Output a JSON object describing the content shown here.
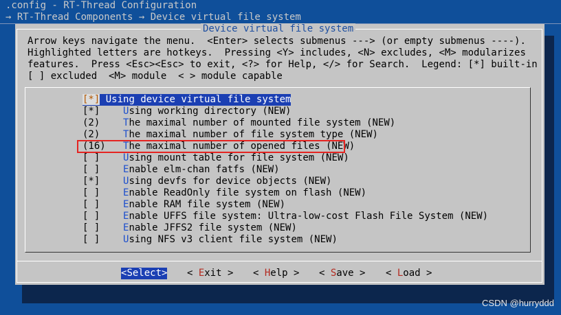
{
  "terminal": {
    "title": ".config - RT-Thread Configuration",
    "breadcrumb": "→ RT-Thread Components → Device virtual file system"
  },
  "dialog": {
    "title": "Device virtual file system",
    "help_lines": [
      "Arrow keys navigate the menu.  <Enter> selects submenus ---> (or empty submenus ----).",
      "Highlighted letters are hotkeys.  Pressing <Y> includes, <N> excludes, <M> modularizes",
      "features.  Press <Esc><Esc> to exit, <?> for Help, </> for Search.  Legend: [*] built-in",
      "[ ] excluded  <M> module  < > module capable"
    ]
  },
  "menu": {
    "items": [
      {
        "mark": "[*]",
        "hotkey": "U",
        "rest": "sing device virtual file system",
        "selected": true
      },
      {
        "mark": "[*]",
        "hotkey": "U",
        "rest": "sing working directory (NEW)"
      },
      {
        "mark": "(2)",
        "hotkey": "T",
        "rest": "he maximal number of mounted file system (NEW)"
      },
      {
        "mark": "(2)",
        "hotkey": "T",
        "rest": "he maximal number of file system type (NEW)"
      },
      {
        "mark": "(16)",
        "hotkey": "T",
        "rest": "he maximal number of opened files (NEW)",
        "highlighted": true
      },
      {
        "mark": "[ ]",
        "hotkey": "U",
        "rest": "sing mount table for file system (NEW)"
      },
      {
        "mark": "[ ]",
        "hotkey": "E",
        "rest": "nable elm-chan fatfs (NEW)"
      },
      {
        "mark": "[*]",
        "hotkey": "U",
        "rest": "sing devfs for device objects (NEW)"
      },
      {
        "mark": "[ ]",
        "hotkey": "E",
        "rest": "nable ReadOnly file system on flash (NEW)"
      },
      {
        "mark": "[ ]",
        "hotkey": "E",
        "rest": "nable RAM file system (NEW)"
      },
      {
        "mark": "[ ]",
        "hotkey": "E",
        "rest": "nable UFFS file system: Ultra-low-cost Flash File System (NEW)"
      },
      {
        "mark": "[ ]",
        "hotkey": "E",
        "rest": "nable JFFS2 file system (NEW)"
      },
      {
        "mark": "[ ]",
        "hotkey": "U",
        "rest": "sing NFS v3 client file system (NEW)"
      }
    ]
  },
  "buttons": {
    "select": {
      "pre": "<",
      "hotkey": "S",
      "post": "elect>"
    },
    "exit": {
      "pre": "< ",
      "hotkey": "E",
      "post": "xit >"
    },
    "help": {
      "pre": "< ",
      "hotkey": "H",
      "post": "elp >"
    },
    "save": {
      "pre": "< ",
      "hotkey": "S",
      "post": "ave >"
    },
    "load": {
      "pre": "< ",
      "hotkey": "L",
      "post": "oad >"
    }
  },
  "watermark": "CSDN @hurryddd",
  "colors": {
    "terminal_bg": "#0f4f9a",
    "dialog_bg": "#c5c5c5",
    "selection": "#1b3fb3",
    "hotkey": "#1d4fcc",
    "annotation_red": "#e52421"
  }
}
